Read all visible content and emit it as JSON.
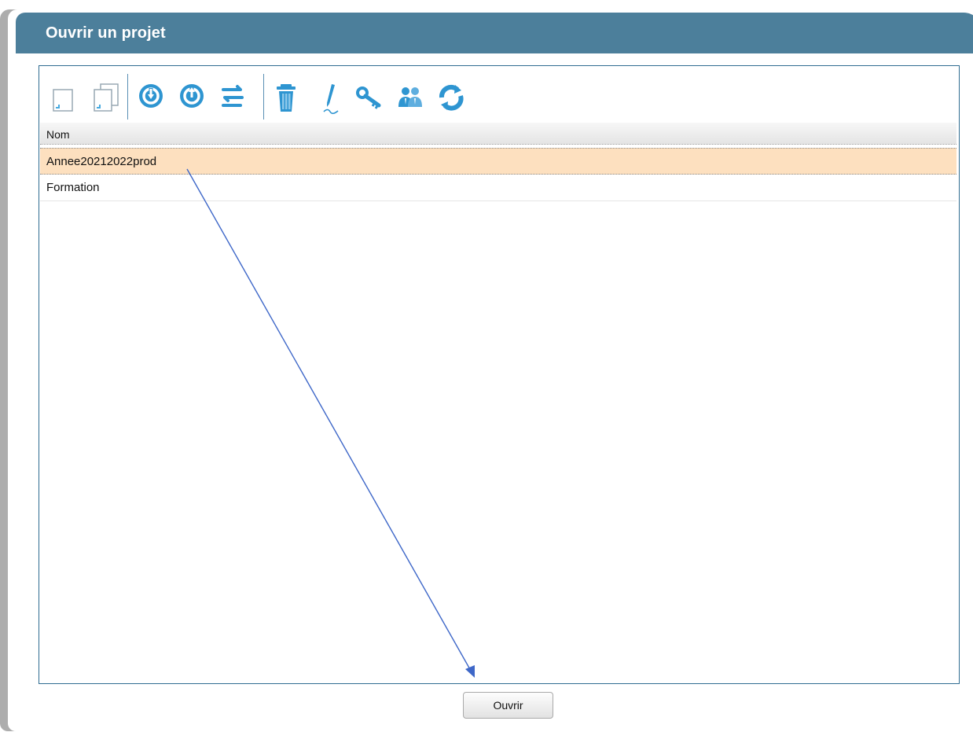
{
  "window": {
    "title": "Ouvrir un projet"
  },
  "toolbar": {
    "icons": [
      "new-document-icon",
      "duplicate-document-icon",
      "download-icon",
      "upload-icon",
      "transfer-icon",
      "trash-icon",
      "rename-icon",
      "key-icon",
      "users-icon",
      "refresh-icon"
    ]
  },
  "grid": {
    "column_header": "Nom",
    "rows": [
      {
        "name": "Annee20212022prod",
        "selected": true
      },
      {
        "name": "Formation",
        "selected": false
      }
    ]
  },
  "actions": {
    "open_label": "Ouvrir"
  },
  "colors": {
    "titlebar": "#4c7f9b",
    "panel_border": "#2f6c91",
    "selected_row": "#fde0bf",
    "icon_blue": "#2e95d1",
    "annotation_arrow": "#3e67c8"
  }
}
